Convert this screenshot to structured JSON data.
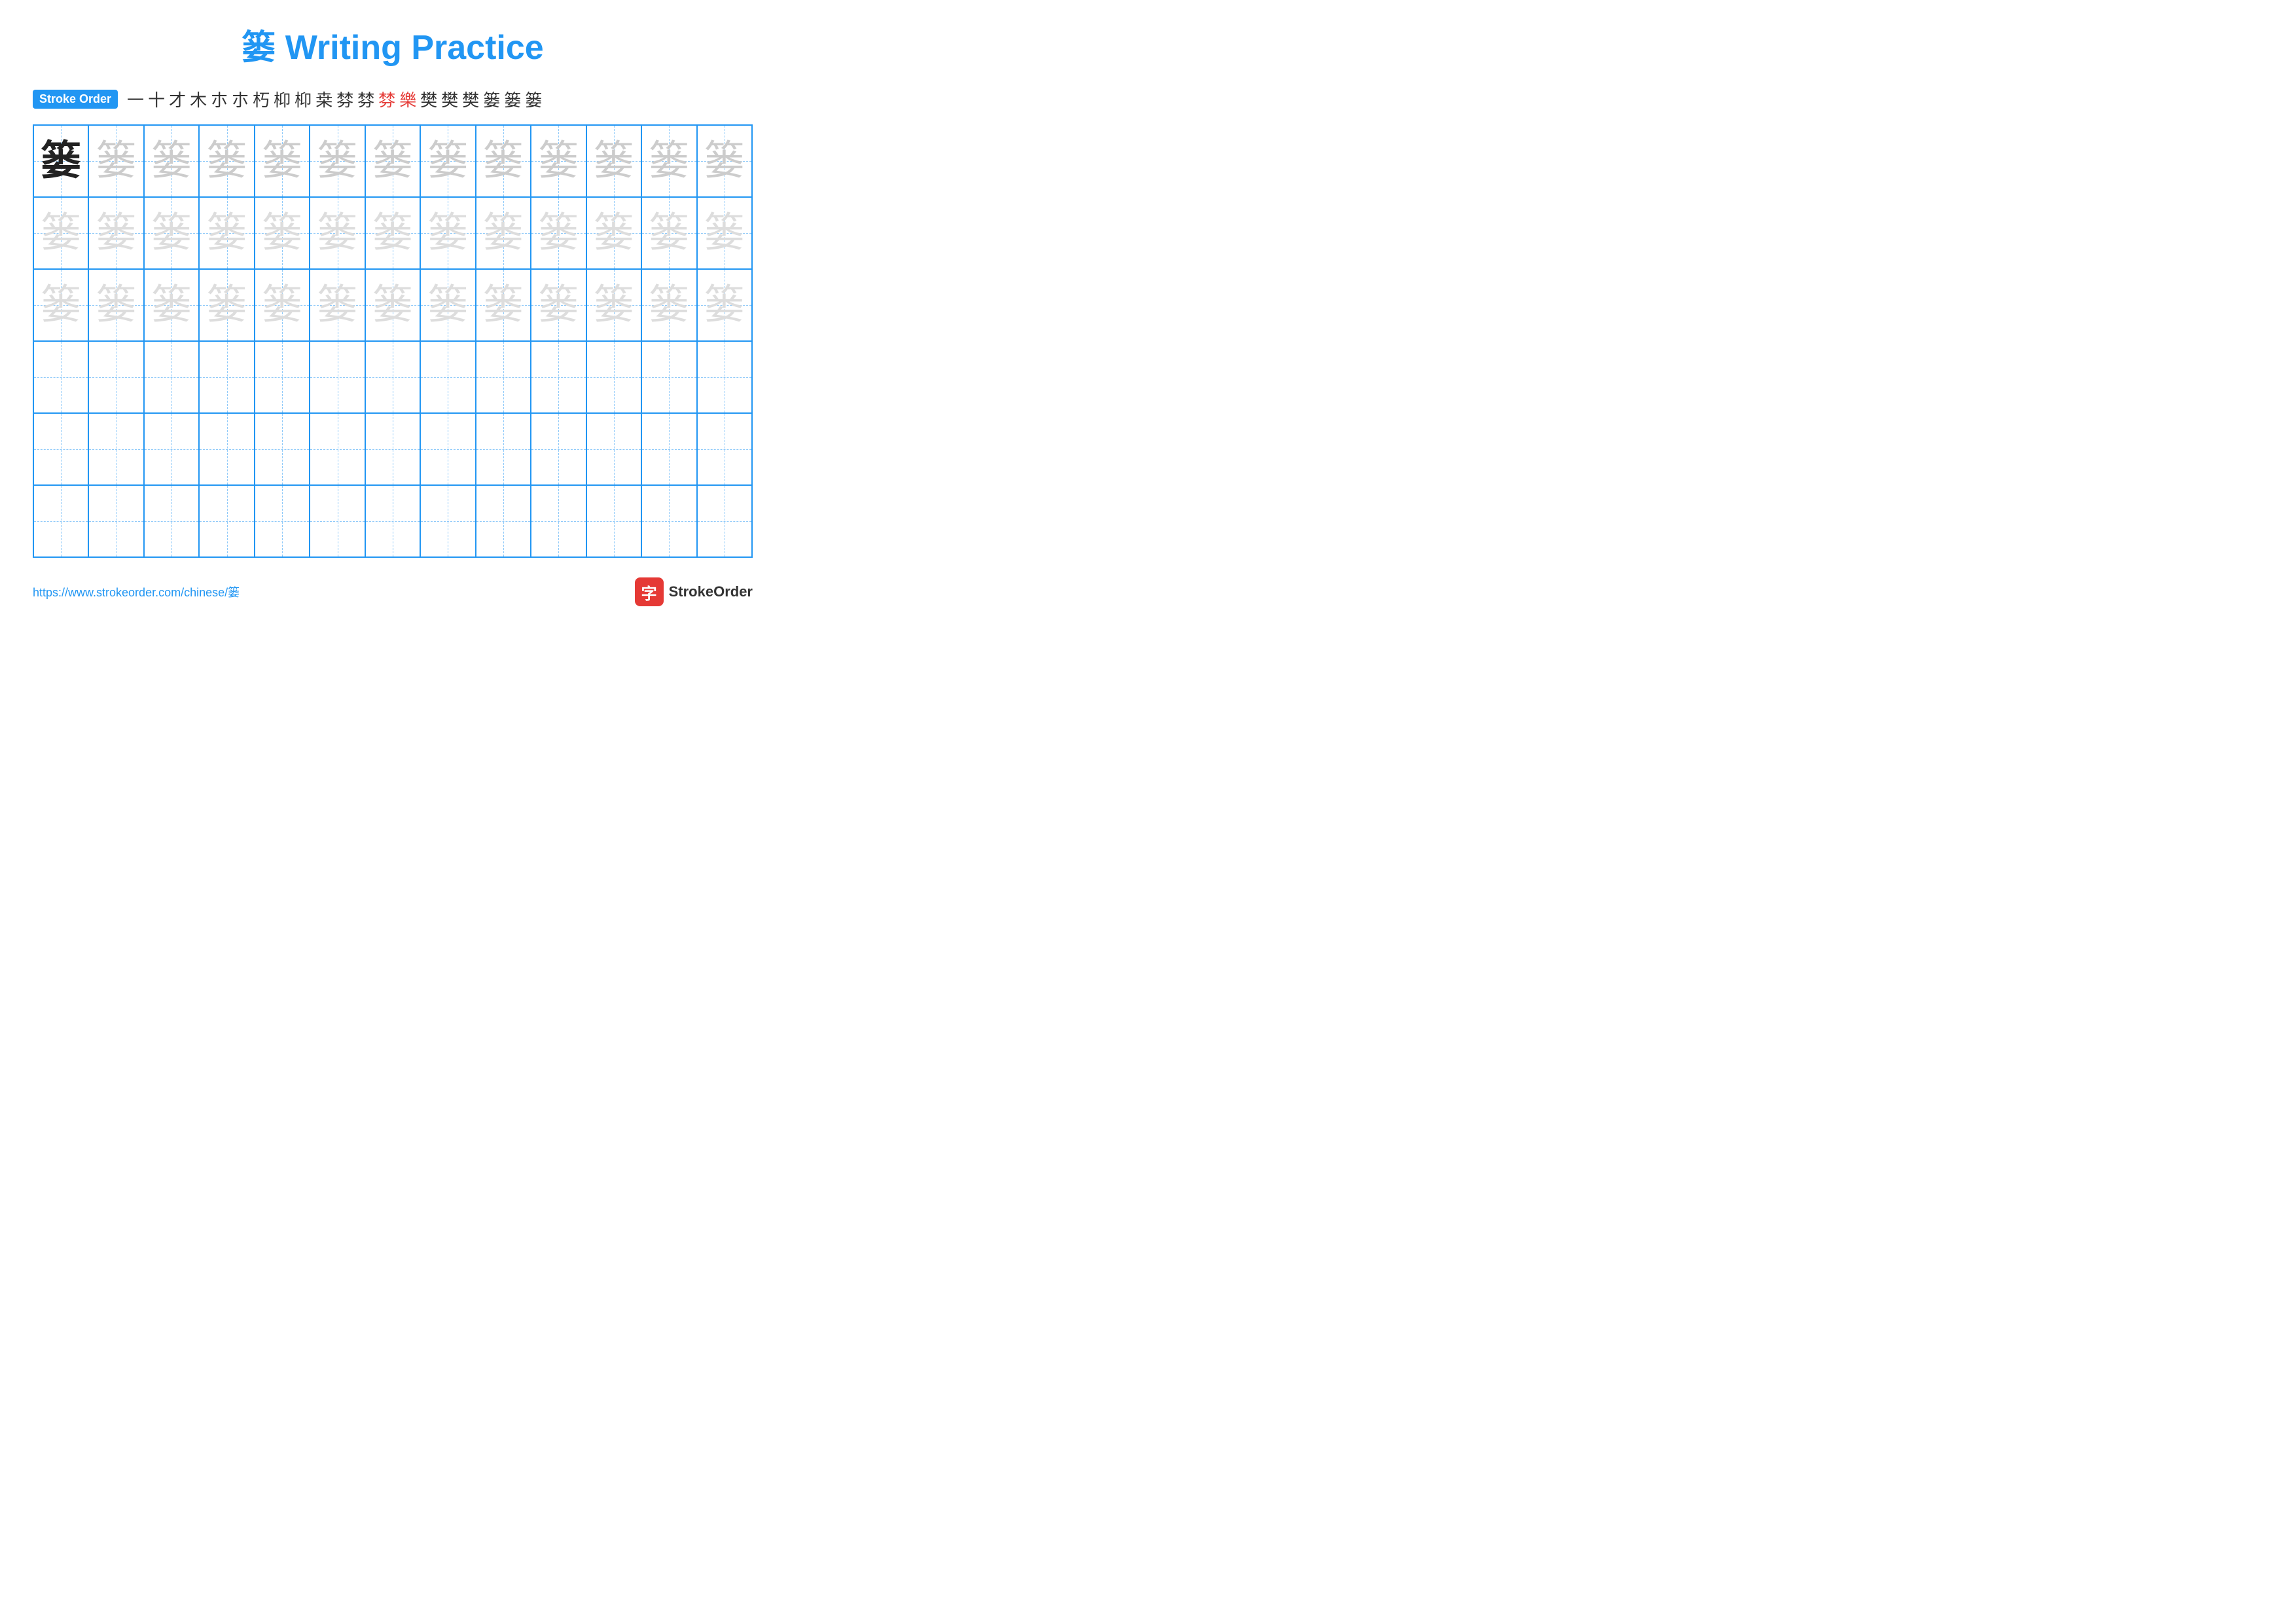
{
  "title": {
    "main": "篓 Writing Practice",
    "char": "篓",
    "text": "Writing Practice"
  },
  "stroke_order": {
    "badge_label": "Stroke Order",
    "strokes": [
      {
        "char": "一",
        "red": false
      },
      {
        "char": "十",
        "red": false
      },
      {
        "char": "才",
        "red": false
      },
      {
        "char": "木",
        "red": false
      },
      {
        "char": "朩",
        "red": false
      },
      {
        "char": "朩",
        "red": false
      },
      {
        "char": "朽",
        "red": false
      },
      {
        "char": "枊",
        "red": false
      },
      {
        "char": "枊",
        "red": false
      },
      {
        "char": "桒",
        "red": false
      },
      {
        "char": "棼",
        "red": false
      },
      {
        "char": "棼",
        "red": false
      },
      {
        "char": "棼",
        "red": true
      },
      {
        "char": "樂",
        "red": true
      },
      {
        "char": "樊",
        "red": false
      },
      {
        "char": "樊",
        "red": false
      },
      {
        "char": "樊",
        "red": false
      },
      {
        "char": "篓",
        "red": false
      },
      {
        "char": "篓",
        "red": false
      },
      {
        "char": "篓",
        "red": false
      }
    ]
  },
  "grid": {
    "rows": 6,
    "cols": 13,
    "practice_char": "篓",
    "filled_rows": 3
  },
  "footer": {
    "url": "https://www.strokeorder.com/chinese/篓",
    "logo_text": "StrokeOrder",
    "logo_icon": "字"
  }
}
